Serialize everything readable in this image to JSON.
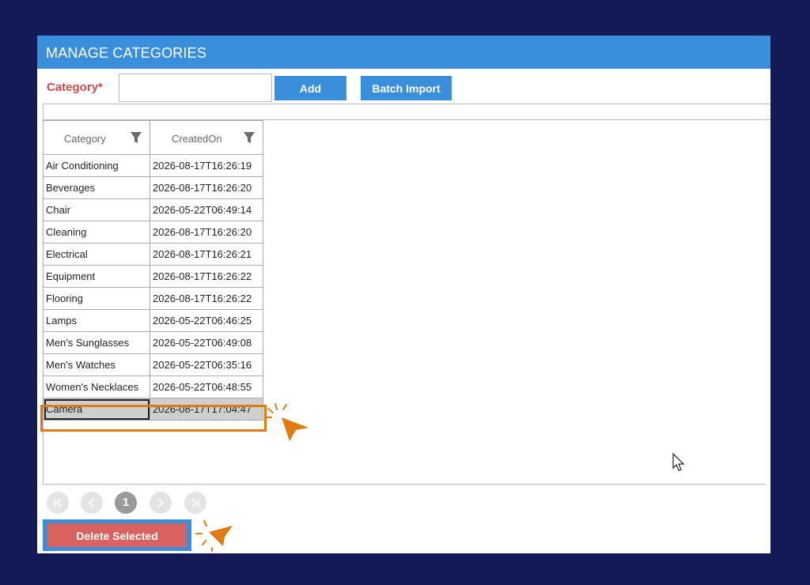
{
  "window": {
    "title": "MANAGE CATEGORIES"
  },
  "form": {
    "category_label": "Category*",
    "category_value": "",
    "add_label": "Add",
    "batch_import_label": "Batch Import"
  },
  "grid": {
    "columns": [
      "Category",
      "CreatedOn"
    ],
    "rows": [
      [
        "Air Conditioning",
        "2026-08-17T16:26:19"
      ],
      [
        "Beverages",
        "2026-08-17T16:26:20"
      ],
      [
        "Chair",
        "2026-05-22T06:49:14"
      ],
      [
        "Cleaning",
        "2026-08-17T16:26:20"
      ],
      [
        "Electrical",
        "2026-08-17T16:26:21"
      ],
      [
        "Equipment",
        "2026-08-17T16:26:22"
      ],
      [
        "Flooring",
        "2026-08-17T16:26:22"
      ],
      [
        "Lamps",
        "2026-05-22T06:46:25"
      ],
      [
        "Men's Sunglasses",
        "2026-05-22T06:49:08"
      ],
      [
        "Men's Watches",
        "2026-05-22T06:35:16"
      ],
      [
        "Women's Necklaces",
        "2026-05-22T06:48:55"
      ],
      [
        "Camera",
        "2026-08-17T17:04:47"
      ]
    ],
    "selected_row": "Camera"
  },
  "pager": {
    "first_icon": "first-page-icon",
    "prev_icon": "prev-page-icon",
    "current_page": "1",
    "next_icon": "next-page-icon",
    "last_icon": "last-page-icon"
  },
  "actions": {
    "delete_label": "Delete Selected"
  },
  "colors": {
    "background": "#141a56",
    "accent": "#3a8fdd",
    "danger": "#d9625f",
    "highlight": "#e07b12"
  }
}
